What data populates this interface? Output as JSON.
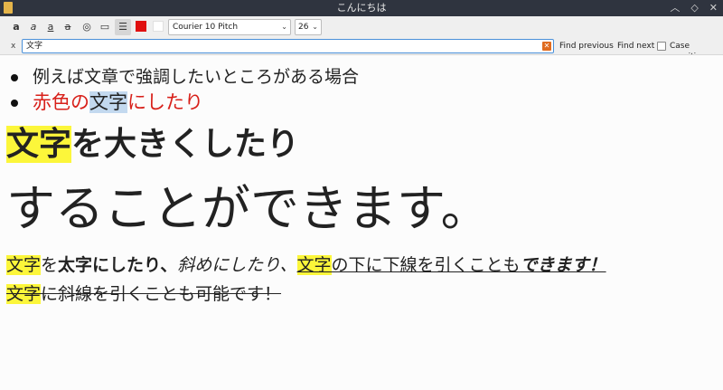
{
  "window": {
    "title": "こんにちは"
  },
  "toolbar": {
    "font": "Courier 10 Pitch",
    "size": "26",
    "colors": {
      "text_color": "#e01010",
      "background_color": "#ffffff"
    }
  },
  "findbar": {
    "close_label": "x",
    "query": "文字",
    "find_previous": "Find previous",
    "find_next": "Find next",
    "case_sensitive": "Case sensitive"
  },
  "doc": {
    "line1": "例えば文章で強調したいところがある場合",
    "line2": {
      "a": "赤色の",
      "b": "文字",
      "c": "にしたり"
    },
    "line3": {
      "a": "文字",
      "b": "を大きくしたり"
    },
    "line4": "することができます。",
    "line5": {
      "a": "文字",
      "b": "を",
      "c": "太字にしたり、",
      "d": "斜めにしたり、",
      "e": "文字",
      "f": "の下に下線を引くことも",
      "g": "できます！"
    },
    "line6": {
      "a": "文字",
      "b": "に斜線を引くことも可能です！"
    }
  }
}
